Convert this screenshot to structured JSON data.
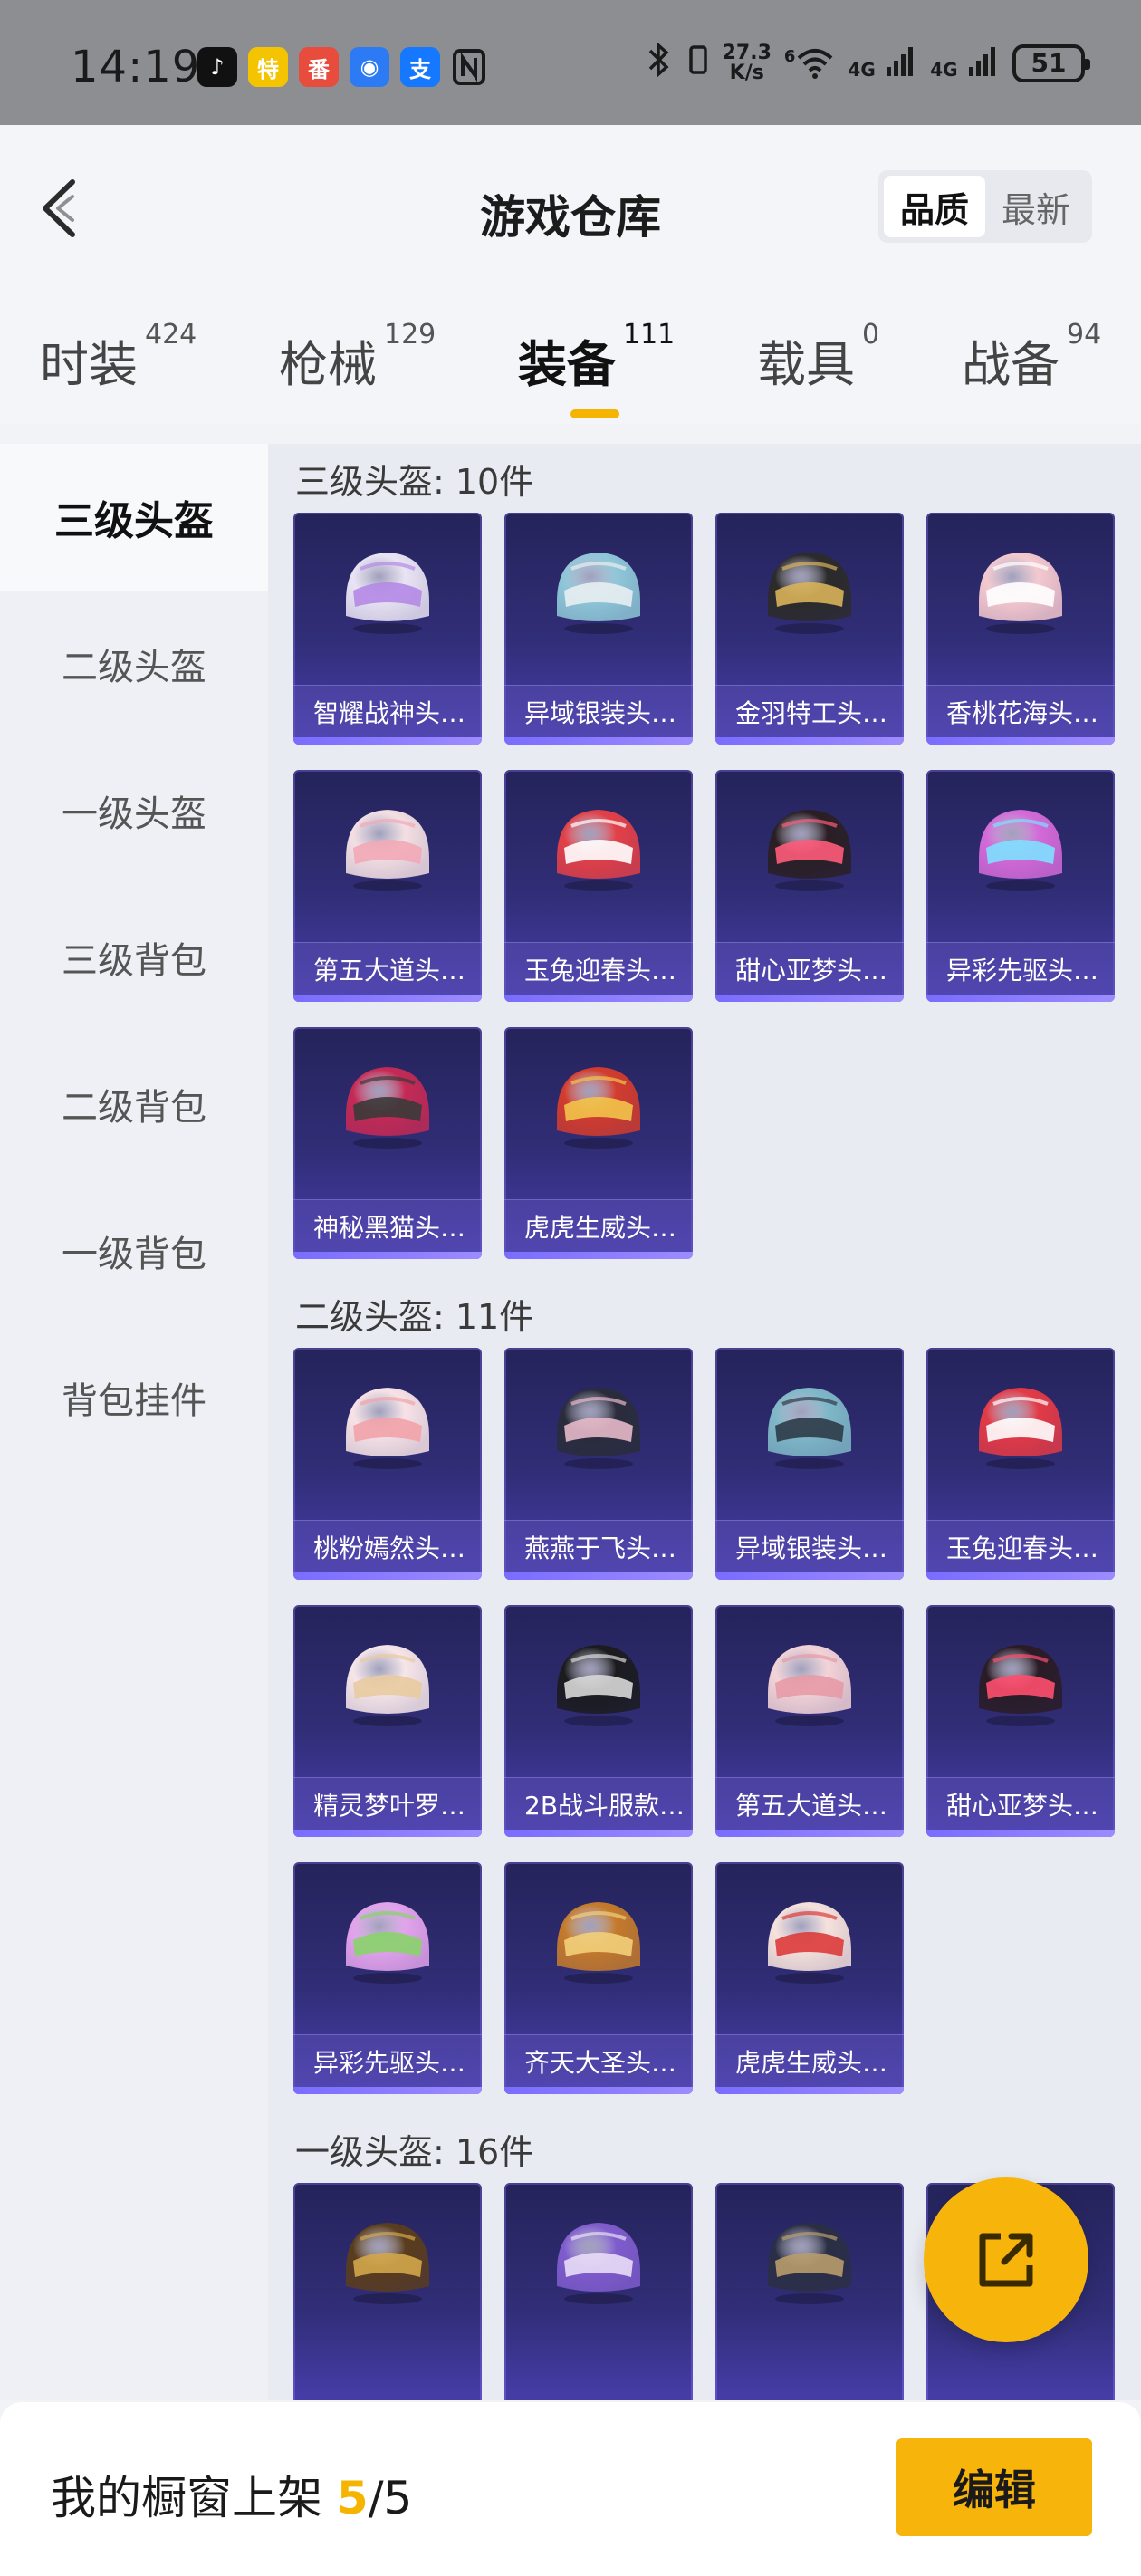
{
  "status_bar": {
    "time": "14:19",
    "apps": [
      {
        "name": "douyin-icon",
        "glyph": "♪",
        "color": "#111111"
      },
      {
        "name": "taobao-special-icon",
        "glyph": "特",
        "color": "#f5c400"
      },
      {
        "name": "fanqie-icon",
        "glyph": "番",
        "color": "#e84c3d"
      },
      {
        "name": "bot-app-icon",
        "glyph": "◉",
        "color": "#2d7bf4"
      },
      {
        "name": "alipay-icon",
        "glyph": "支",
        "color": "#1677ff"
      }
    ],
    "net_speed_value": "27.3",
    "net_speed_unit": "K/s",
    "wifi_label": "6",
    "signal1": "4G",
    "signal2": "4G",
    "battery": "51"
  },
  "header": {
    "title": "游戏仓库",
    "sort_options": [
      "品质",
      "最新"
    ]
  },
  "tabs": [
    {
      "label": "时装",
      "count": "424"
    },
    {
      "label": "枪械",
      "count": "129"
    },
    {
      "label": "装备",
      "count": "111"
    },
    {
      "label": "载具",
      "count": "0"
    },
    {
      "label": "战备",
      "count": "94"
    }
  ],
  "sidebar": {
    "items": [
      "三级头盔",
      "二级头盔",
      "一级头盔",
      "三级背包",
      "二级背包",
      "一级背包",
      "背包挂件"
    ]
  },
  "sections": [
    {
      "title": "三级头盔: 10件",
      "items": [
        {
          "name": "智耀战神头…",
          "base": "#e9e4f4",
          "accent": "#b48ae6"
        },
        {
          "name": "异域银装头…",
          "base": "#8fc7d8",
          "accent": "#e8eef2"
        },
        {
          "name": "金羽特工头…",
          "base": "#2b2b2b",
          "accent": "#d8b25a"
        },
        {
          "name": "香桃花海头…",
          "base": "#f4c8cf",
          "accent": "#ffffff"
        },
        {
          "name": "第五大道头…",
          "base": "#f3dfe3",
          "accent": "#f2a8b6"
        },
        {
          "name": "玉兔迎春头…",
          "base": "#e24048",
          "accent": "#ffffff"
        },
        {
          "name": "甜心亚梦头…",
          "base": "#2a1f24",
          "accent": "#ff5b7a"
        },
        {
          "name": "异彩先驱头…",
          "base": "#d36ad8",
          "accent": "#7ee0ff"
        },
        {
          "name": "神秘黑猫头…",
          "base": "#c42a55",
          "accent": "#3a3a3a"
        },
        {
          "name": "虎虎生威头…",
          "base": "#d23c2e",
          "accent": "#f2c44a"
        }
      ]
    },
    {
      "title": "二级头盔: 11件",
      "items": [
        {
          "name": "桃粉嫣然头…",
          "base": "#f7e3e6",
          "accent": "#f2a2a8"
        },
        {
          "name": "燕燕于飞头…",
          "base": "#2a2c3c",
          "accent": "#e7b9c9"
        },
        {
          "name": "异域银装头…",
          "base": "#7fb8c8",
          "accent": "#2e3b48"
        },
        {
          "name": "玉兔迎春头…",
          "base": "#e23a46",
          "accent": "#ffffff"
        },
        {
          "name": "精灵梦叶罗…",
          "base": "#f6e6e9",
          "accent": "#e8cba0"
        },
        {
          "name": "2B战斗服款…",
          "base": "#1b1b1f",
          "accent": "#d8d8d8"
        },
        {
          "name": "第五大道头…",
          "base": "#f2d3d7",
          "accent": "#e79aa6"
        },
        {
          "name": "甜心亚梦头…",
          "base": "#2a1c26",
          "accent": "#ff4f6e"
        },
        {
          "name": "异彩先驱头…",
          "base": "#e2a3ec",
          "accent": "#88d36a"
        },
        {
          "name": "齐天大圣头…",
          "base": "#c47a2c",
          "accent": "#f2cf7a"
        },
        {
          "name": "虎虎生威头…",
          "base": "#f6e2dc",
          "accent": "#dd3b3b"
        }
      ]
    },
    {
      "title": "一级头盔: 16件",
      "items": [
        {
          "name": "",
          "base": "#5a3d1e",
          "accent": "#d3a64a"
        },
        {
          "name": "",
          "base": "#7f5ccd",
          "accent": "#e9ddf7"
        },
        {
          "name": "",
          "base": "#2b2f45",
          "accent": "#b89c6c"
        },
        {
          "name": "",
          "base": "#2f6a4a",
          "accent": "#8ad3a6"
        }
      ]
    }
  ],
  "bottom_bar": {
    "label": "我的橱窗上架",
    "count": "5",
    "total": "/5",
    "edit_label": "编辑"
  },
  "colors": {
    "accent": "#f7b50c",
    "card_top": "#25235a",
    "card_bottom": "#4a3fb0"
  }
}
